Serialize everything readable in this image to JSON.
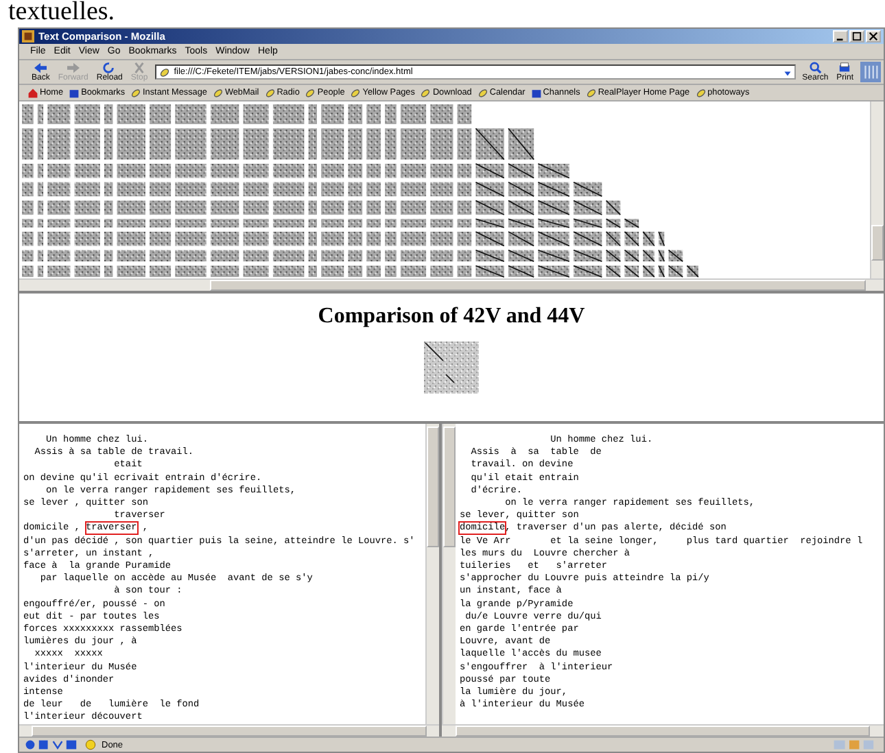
{
  "page_fragment": "textuelles.",
  "window": {
    "title": "Text Comparison - Mozilla"
  },
  "menu": [
    "File",
    "Edit",
    "View",
    "Go",
    "Bookmarks",
    "Tools",
    "Window",
    "Help"
  ],
  "toolbar": {
    "buttons": [
      {
        "label": "Back",
        "kind": "back",
        "disabled": false
      },
      {
        "label": "Forward",
        "kind": "forward",
        "disabled": true
      },
      {
        "label": "Reload",
        "kind": "reload",
        "disabled": false
      },
      {
        "label": "Stop",
        "kind": "stop",
        "disabled": true
      }
    ],
    "address": "file:///C:/Fekete/ITEM/jabs/VERSION1/jabes-conc/index.html",
    "right_buttons": [
      {
        "label": "Search",
        "kind": "search"
      },
      {
        "label": "Print",
        "kind": "print"
      }
    ]
  },
  "bookmarks": [
    {
      "label": "Home",
      "kind": "home"
    },
    {
      "label": "Bookmarks",
      "kind": "folder"
    },
    {
      "label": "Instant Message",
      "kind": "link"
    },
    {
      "label": "WebMail",
      "kind": "link"
    },
    {
      "label": "Radio",
      "kind": "link"
    },
    {
      "label": "People",
      "kind": "link"
    },
    {
      "label": "Yellow Pages",
      "kind": "link"
    },
    {
      "label": "Download",
      "kind": "link"
    },
    {
      "label": "Calendar",
      "kind": "link"
    },
    {
      "label": "Channels",
      "kind": "folder"
    },
    {
      "label": "RealPlayer Home Page",
      "kind": "link"
    },
    {
      "label": "photoways",
      "kind": "link"
    }
  ],
  "heading": "Comparison of 42V and 44V",
  "left_text": [
    {
      "kind": "plain",
      "text": "    Un homme chez lui."
    },
    {
      "kind": "plain",
      "text": "  Assis à sa table de travail."
    },
    {
      "kind": "plain",
      "text": "                etait"
    },
    {
      "kind": "plain",
      "text": "on devine qu'il ecrivait entrain d'écrire."
    },
    {
      "kind": "plain",
      "text": "    on le verra ranger rapidement ses feuillets,"
    },
    {
      "kind": "plain",
      "text": "se lever , quitter son"
    },
    {
      "kind": "plain",
      "text": "                traverser"
    },
    {
      "kind": "marked",
      "pre": "domicile , ",
      "marked": "traverser",
      "post": " ,"
    },
    {
      "kind": "plain",
      "text": "d'un pas décidé , son quartier puis la seine, atteindre le Louvre. s'"
    },
    {
      "kind": "plain",
      "text": "s'arreter, un instant ,"
    },
    {
      "kind": "plain",
      "text": "face à  la grande Puramide"
    },
    {
      "kind": "plain",
      "text": "   par laquelle on accède au Musée  avant de se s'y"
    },
    {
      "kind": "plain",
      "text": "                à son tour :"
    },
    {
      "kind": "plain",
      "text": "engouffré/er, poussé - on"
    },
    {
      "kind": "plain",
      "text": "eut dit - par toutes les"
    },
    {
      "kind": "plain",
      "text": "forces xxxxxxxxx rassemblées"
    },
    {
      "kind": "plain",
      "text": "lumières du jour , à"
    },
    {
      "kind": "plain",
      "text": "  xxxxx  xxxxx"
    },
    {
      "kind": "plain",
      "text": "l'interieur du Musée"
    },
    {
      "kind": "plain",
      "text": "avides d'inonder"
    },
    {
      "kind": "plain",
      "text": "intense"
    },
    {
      "kind": "plain",
      "text": "de leur   de   lumière  le fond"
    },
    {
      "kind": "plain",
      "text": "l'interieur découvert"
    }
  ],
  "right_text": [
    {
      "kind": "plain",
      "text": "                Un homme chez lui."
    },
    {
      "kind": "plain",
      "text": "  Assis  à  sa  table  de"
    },
    {
      "kind": "plain",
      "text": "  travail. on devine"
    },
    {
      "kind": "plain",
      "text": "  qu'il etait entrain"
    },
    {
      "kind": "plain",
      "text": "  d'écrire."
    },
    {
      "kind": "plain",
      "text": "        on le verra ranger rapidement ses feuillets,"
    },
    {
      "kind": "plain",
      "text": "se lever, quitter son"
    },
    {
      "kind": "marked",
      "marked": "domicile",
      "post": ", traverser d'un pas alerte, décidé son"
    },
    {
      "kind": "plain",
      "text": "le Ve Arr       et la seine longer,     plus tard quartier  rejoindre l"
    },
    {
      "kind": "plain",
      "text": "les murs du  Louvre chercher à"
    },
    {
      "kind": "plain",
      "text": "tuileries   et   s'arreter"
    },
    {
      "kind": "plain",
      "text": "s'approcher du Louvre puis atteindre la pi/y"
    },
    {
      "kind": "plain",
      "text": "un instant, face à"
    },
    {
      "kind": "plain",
      "text": "la grande p/Pyramide"
    },
    {
      "kind": "plain",
      "text": " du/e Louvre verre du/qui"
    },
    {
      "kind": "plain",
      "text": "en garde l'entrée par"
    },
    {
      "kind": "plain",
      "text": "Louvre, avant de"
    },
    {
      "kind": "plain",
      "text": "laquelle l'accès du musee"
    },
    {
      "kind": "plain",
      "text": "s'engouffrer  à l'interieur"
    },
    {
      "kind": "plain",
      "text": "poussé par toute"
    },
    {
      "kind": "plain",
      "text": "la lumière du jour,"
    },
    {
      "kind": "plain",
      "text": "à l'interieur du Musée"
    }
  ],
  "status_bar": {
    "text": "Done"
  }
}
